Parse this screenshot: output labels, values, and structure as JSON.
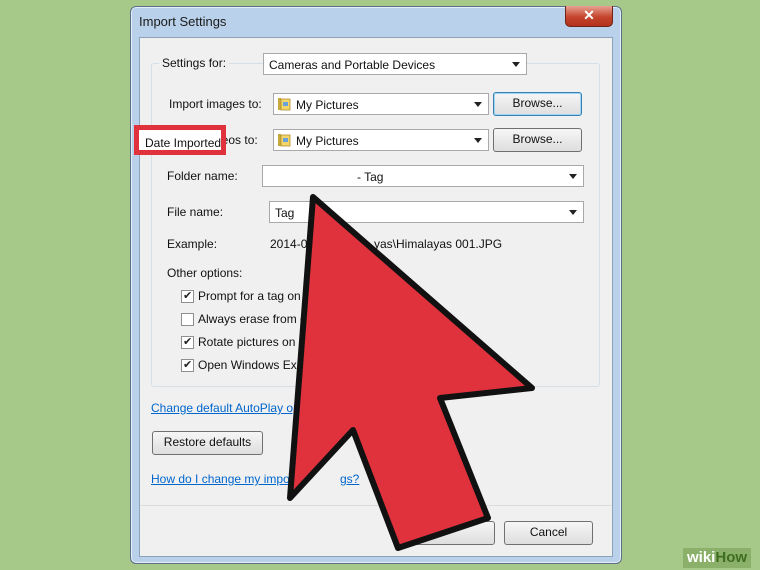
{
  "window": {
    "title": "Import Settings",
    "close_symbol": "✕"
  },
  "settings_for": {
    "label": "Settings for:",
    "value": "Cameras and Portable Devices"
  },
  "import_images": {
    "label": "Import images to:",
    "value": "My Pictures",
    "browse_label": "Browse..."
  },
  "import_videos": {
    "label": "Import videos to:",
    "value": "My Pictures",
    "browse_label": "Browse..."
  },
  "folder_name": {
    "label": "Folder name:",
    "value_highlight": "Date Imported",
    "value_rest": "- Tag"
  },
  "file_name": {
    "label": "File name:",
    "value": "Tag"
  },
  "example": {
    "label": "Example:",
    "value_start": "2014-05",
    "value_end": "yas\\Himalayas 001.JPG"
  },
  "other_options": {
    "label": "Other options:",
    "items": [
      {
        "label": "Prompt for a tag on i",
        "checked": true
      },
      {
        "label": "Always erase from de",
        "checked": false
      },
      {
        "label": "Rotate pictures on im",
        "checked": true
      },
      {
        "label": "Open Windows Explo",
        "checked": true
      }
    ]
  },
  "autoplay_link": "Change default AutoPlay opti",
  "restore_defaults_label": "Restore defaults",
  "help_link_start": "How do I change my import",
  "help_link_end": "gs?",
  "ok_label": "",
  "cancel_label": "Cancel",
  "checkmark": "✔",
  "watermark": {
    "wiki": "wiki",
    "how": "How"
  },
  "colors": {
    "highlight_red": "#e0323c",
    "arrow_red": "#e0323c",
    "link_blue": "#0066cc",
    "background": "#a6c98a"
  }
}
